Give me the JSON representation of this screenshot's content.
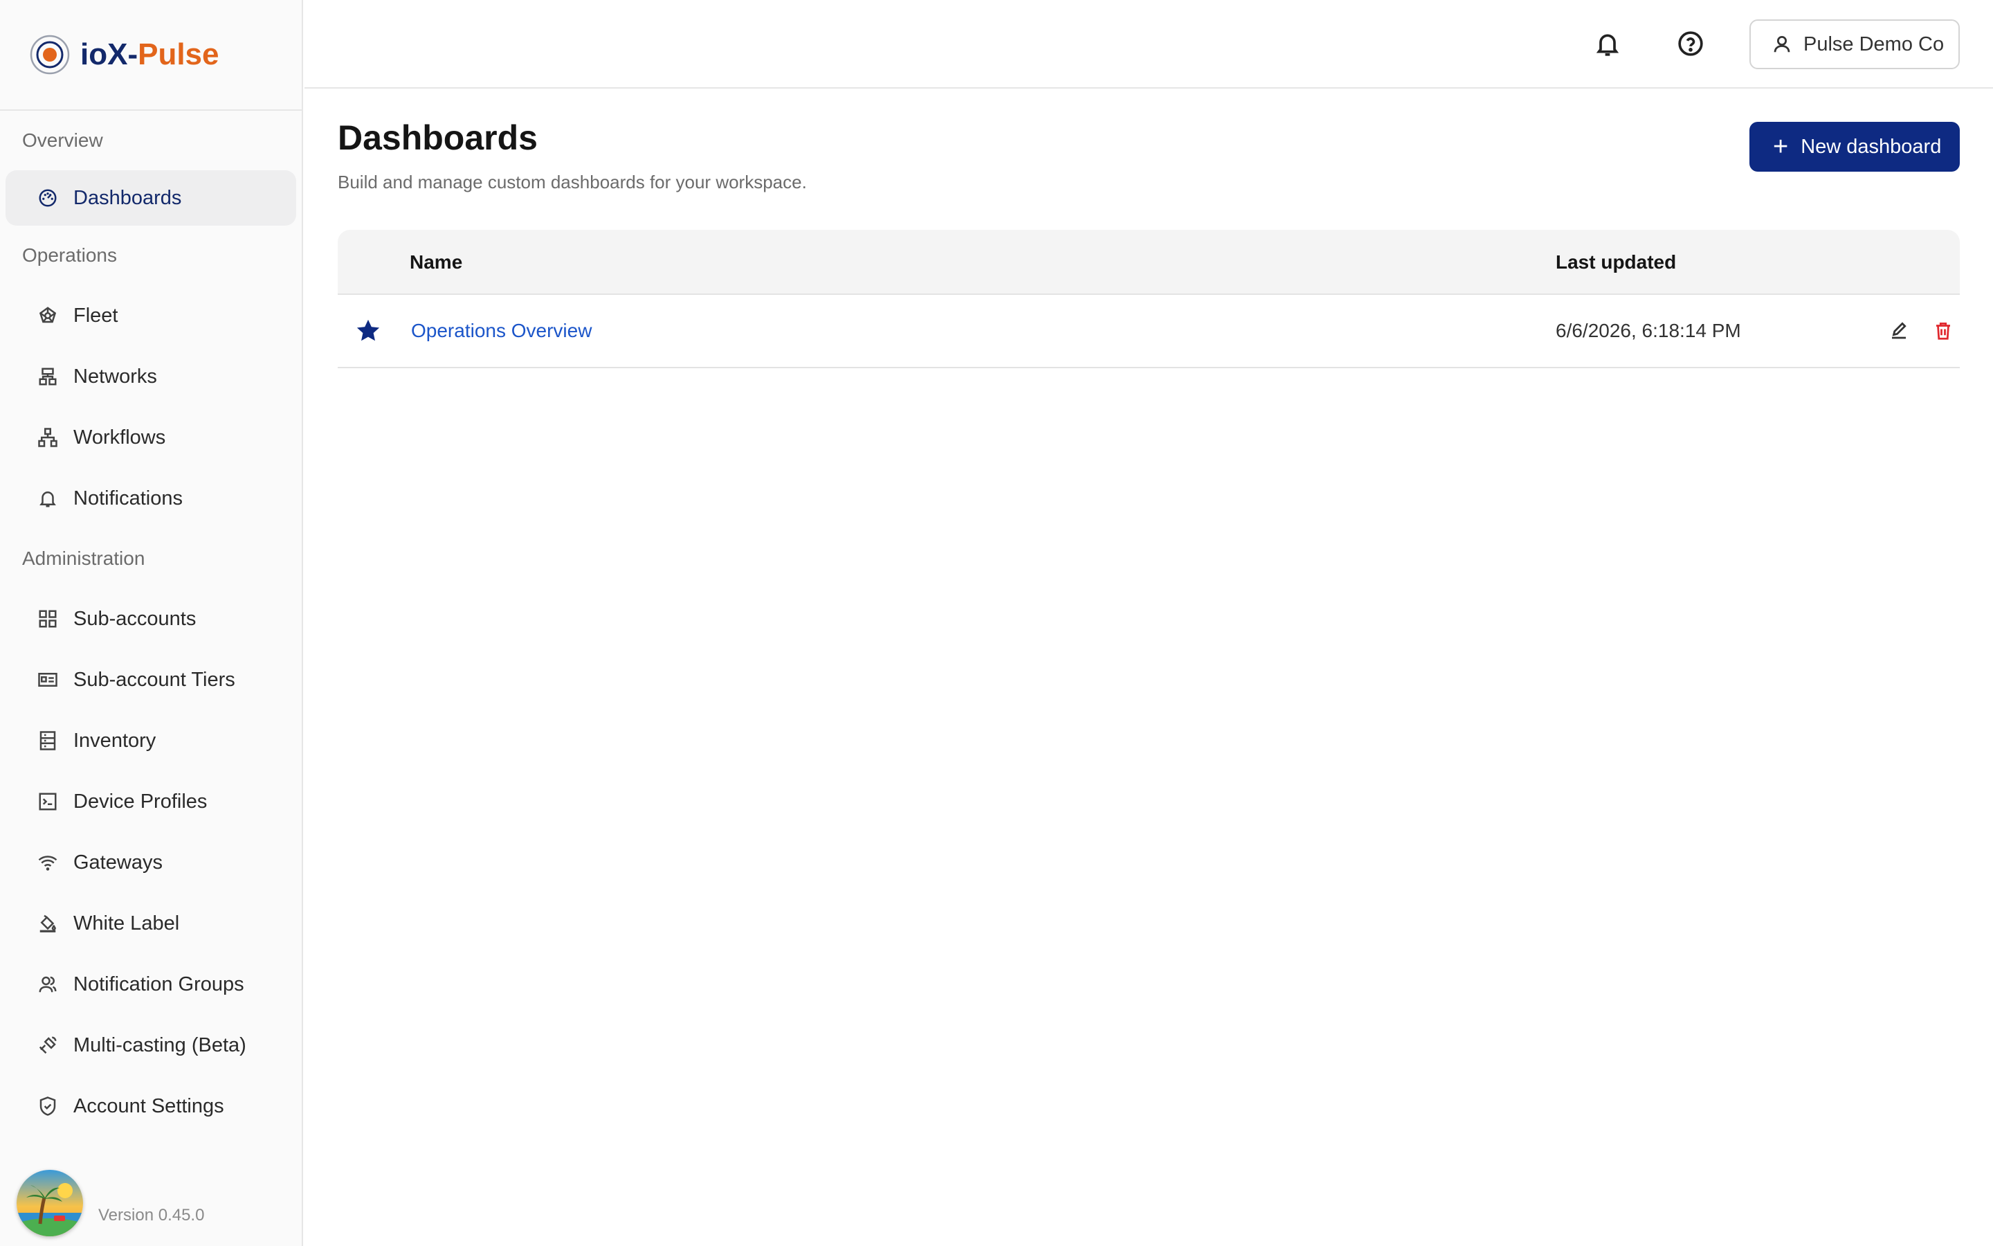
{
  "app": {
    "name_part1": "ioX",
    "name_sep": "-",
    "name_part2": "Pulse"
  },
  "colors": {
    "brand_navy": "#13296b",
    "brand_orange": "#e2651b",
    "primary_button": "#0e2a82",
    "link": "#1b55c9",
    "danger": "#e0282e"
  },
  "sidebar": {
    "sections": [
      {
        "label": "Overview",
        "items": [
          {
            "label": "Dashboards",
            "icon": "gauge-icon",
            "active": true
          }
        ]
      },
      {
        "label": "Operations",
        "items": [
          {
            "label": "Fleet",
            "icon": "fleet-icon"
          },
          {
            "label": "Networks",
            "icon": "network-icon"
          },
          {
            "label": "Workflows",
            "icon": "workflow-icon"
          },
          {
            "label": "Notifications",
            "icon": "bell-icon"
          }
        ]
      },
      {
        "label": "Administration",
        "items": [
          {
            "label": "Sub-accounts",
            "icon": "grid-icon"
          },
          {
            "label": "Sub-account Tiers",
            "icon": "id-card-icon"
          },
          {
            "label": "Inventory",
            "icon": "inventory-icon"
          },
          {
            "label": "Device Profiles",
            "icon": "terminal-icon"
          },
          {
            "label": "Gateways",
            "icon": "wifi-icon"
          },
          {
            "label": "White Label",
            "icon": "paint-bucket-icon"
          },
          {
            "label": "Notification Groups",
            "icon": "users-icon"
          },
          {
            "label": "Multi-casting (Beta)",
            "icon": "satellite-icon"
          },
          {
            "label": "Account Settings",
            "icon": "shield-icon"
          }
        ]
      }
    ],
    "version": "Version 0.45.0"
  },
  "header": {
    "account_label": "Pulse Demo Co"
  },
  "main": {
    "title": "Dashboards",
    "subtitle": "Build and manage custom dashboards for your workspace.",
    "new_button_label": "New dashboard",
    "table": {
      "columns": [
        "Name",
        "Last updated"
      ],
      "rows": [
        {
          "name": "Operations Overview",
          "last_updated": "6/6/2026, 6:18:14 PM",
          "starred": true
        }
      ]
    }
  }
}
